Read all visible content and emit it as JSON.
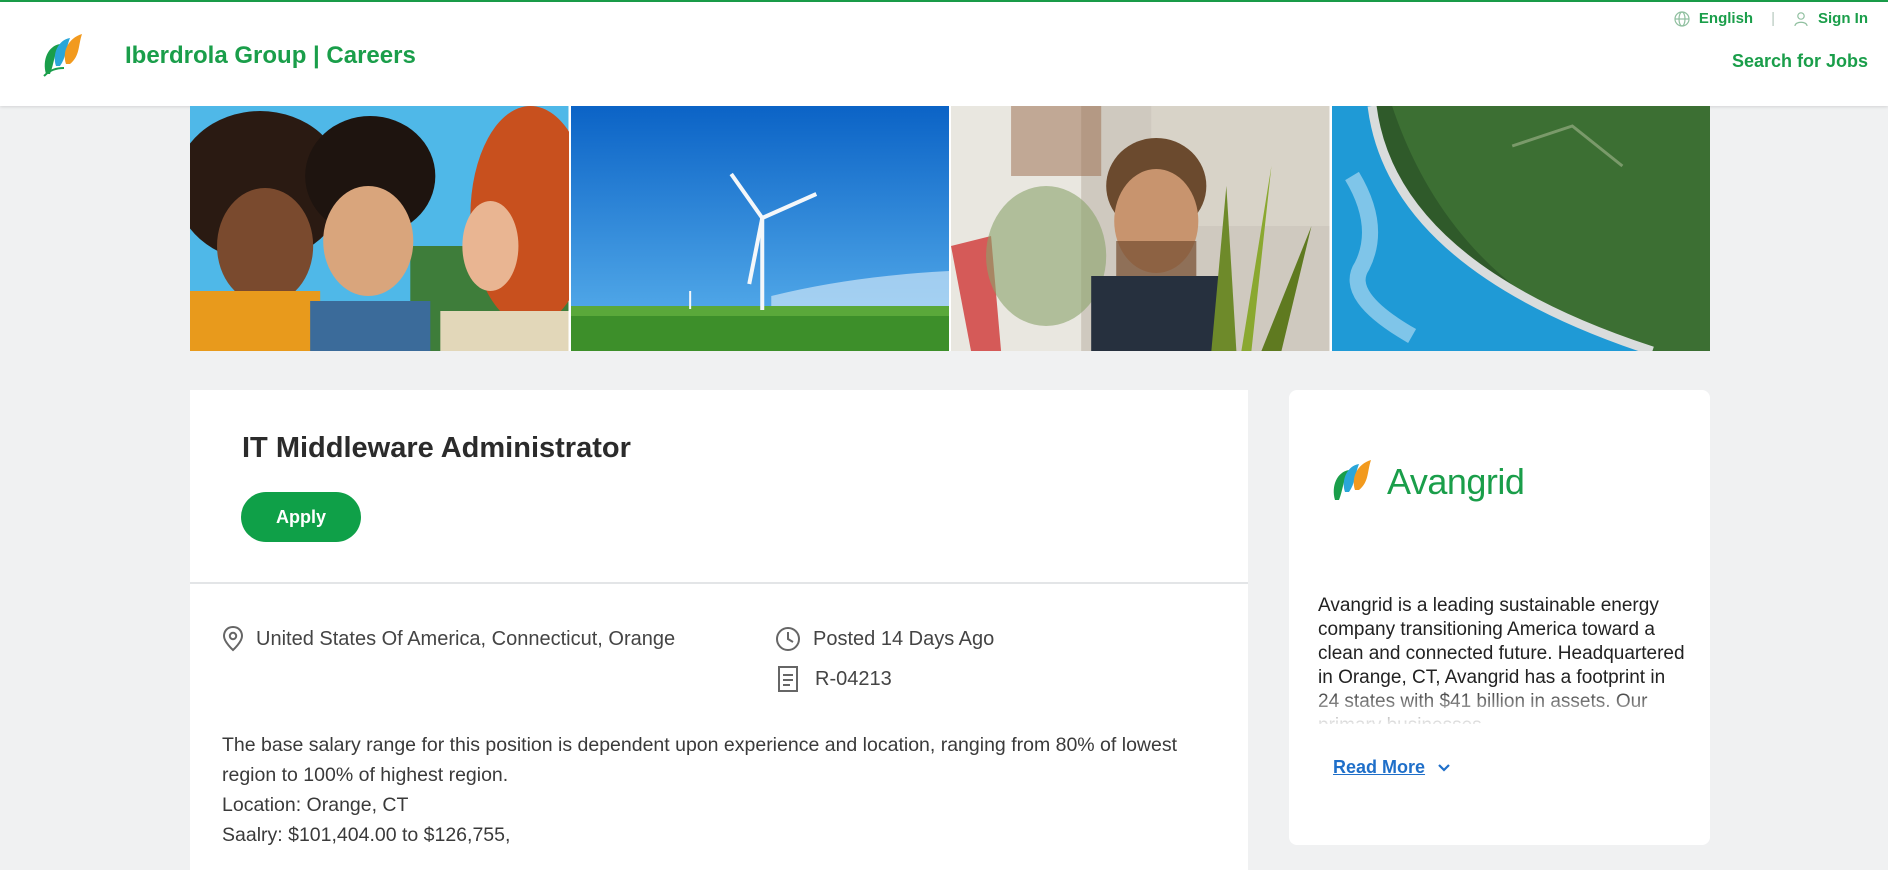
{
  "header": {
    "brand_title": "Iberdrola Group | Careers",
    "language_label": "English",
    "sign_in_label": "Sign In",
    "search_jobs_label": "Search for Jobs",
    "accent_color": "#1a9e4a"
  },
  "hero": {
    "images": [
      "people-smiling-image",
      "wind-turbine-image",
      "man-with-plant-image",
      "dam-reservoir-image"
    ]
  },
  "job": {
    "title": "IT Middleware Administrator",
    "apply_label": "Apply",
    "location": "United States Of America, Connecticut, Orange",
    "posted": "Posted 14 Days Ago",
    "requisition_id": "R-04213",
    "description_lines": [
      "The base salary range for this position is dependent upon experience and location, ranging from 80% of lowest region to 100% of highest region.",
      "Location: Orange, CT",
      "Saalry: $101,404.00 to $126,755,"
    ]
  },
  "company": {
    "logo_text": "Avangrid",
    "about": "Avangrid is a leading sustainable energy company transitioning America toward a clean and connected future. Headquartered in Orange, CT, Avangrid has a footprint in 24 states with $41 billion in assets. Our primary businesses",
    "read_more_label": "Read More",
    "link_color": "#1f6fc9"
  }
}
